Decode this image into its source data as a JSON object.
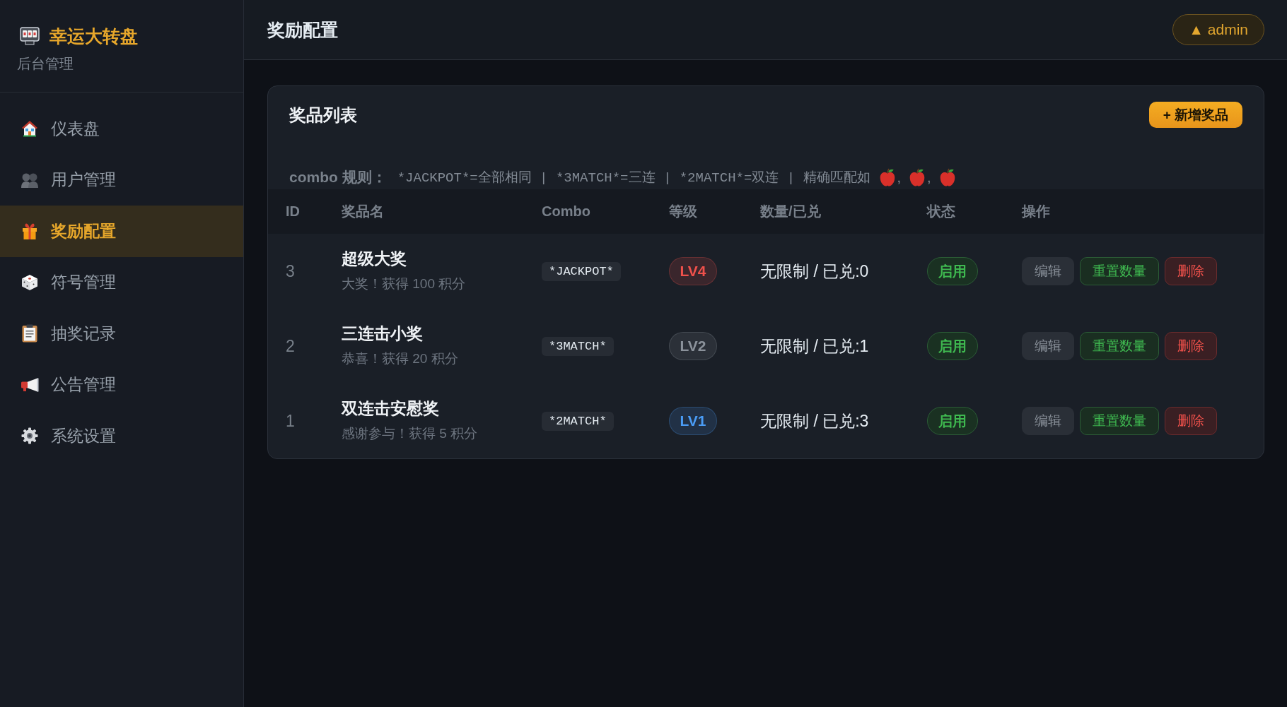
{
  "sidebar": {
    "brand": {
      "title": "幸运大转盘",
      "subtitle": "后台管理"
    },
    "items": [
      {
        "label": "仪表盘",
        "selected": false
      },
      {
        "label": "用户管理",
        "selected": false
      },
      {
        "label": "奖励配置",
        "selected": true
      },
      {
        "label": "符号管理",
        "selected": false
      },
      {
        "label": "抽奖记录",
        "selected": false
      },
      {
        "label": "公告管理",
        "selected": false
      },
      {
        "label": "系统设置",
        "selected": false
      }
    ]
  },
  "header": {
    "title": "奖励配置",
    "user_badge": "▲ admin"
  },
  "prize_panel": {
    "title": "奖品列表",
    "add_button": "+ 新增奖品",
    "combo_rule": {
      "label": "combo 规则：",
      "text": "*JACKPOT*=全部相同 | *3MATCH*=三连 | *2MATCH*=双连 | 精确匹配如",
      "example_separators": [
        ",",
        ","
      ]
    },
    "table": {
      "columns": [
        "ID",
        "奖品名",
        "Combo",
        "等级",
        "数量/已兑",
        "状态",
        "操作"
      ],
      "rows": [
        {
          "id": "3",
          "name": "超级大奖",
          "description": "大奖！获得 100 积分",
          "combo": "*JACKPOT*",
          "tier": {
            "label": "LV4",
            "color": "#f0514b"
          },
          "quantity": "无限制 / 已兑:0",
          "status": {
            "label": "启用",
            "enabled": true
          },
          "actions": [
            {
              "label": "编辑",
              "kind": "neutral"
            },
            {
              "label": "重置数量",
              "kind": "success"
            },
            {
              "label": "删除",
              "kind": "danger"
            }
          ]
        },
        {
          "id": "2",
          "name": "三连击小奖",
          "description": "恭喜！获得 20 积分",
          "combo": "*3MATCH*",
          "tier": {
            "label": "LV2",
            "color": "#8b929b"
          },
          "quantity": "无限制 / 已兑:1",
          "status": {
            "label": "启用",
            "enabled": true
          },
          "actions": [
            {
              "label": "编辑",
              "kind": "neutral"
            },
            {
              "label": "重置数量",
              "kind": "success"
            },
            {
              "label": "删除",
              "kind": "danger"
            }
          ]
        },
        {
          "id": "1",
          "name": "双连击安慰奖",
          "description": "感谢参与！获得 5 积分",
          "combo": "*2MATCH*",
          "tier": {
            "label": "LV1",
            "color": "#4a9cf5"
          },
          "quantity": "无限制 / 已兑:3",
          "status": {
            "label": "启用",
            "enabled": true
          },
          "actions": [
            {
              "label": "编辑",
              "kind": "neutral"
            },
            {
              "label": "重置数量",
              "kind": "success"
            },
            {
              "label": "删除",
              "kind": "danger"
            }
          ]
        }
      ]
    }
  }
}
